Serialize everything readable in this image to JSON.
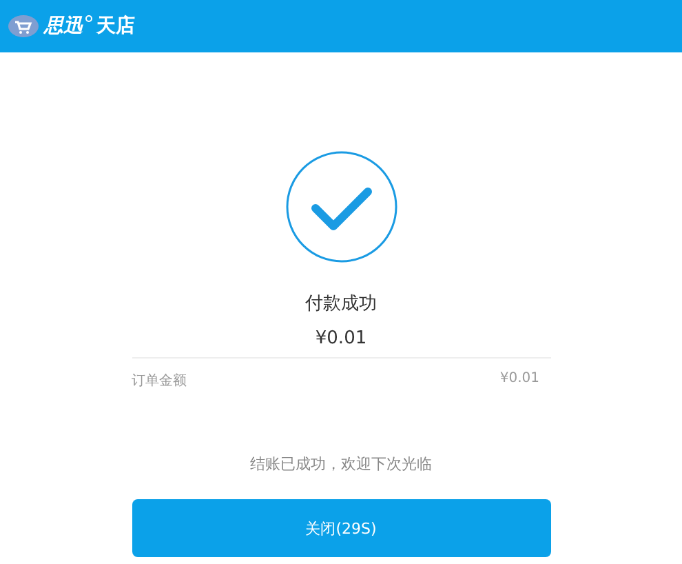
{
  "header": {
    "brand": "思迅",
    "brand_suffix": "天店"
  },
  "status": {
    "title": "付款成功",
    "amount": "¥0.01"
  },
  "details": [
    {
      "label": "订单金额",
      "value": "¥0.01"
    }
  ],
  "message": "结账已成功，欢迎下次光临",
  "buttons": [
    {
      "label": "关闭(29S)"
    }
  ]
}
